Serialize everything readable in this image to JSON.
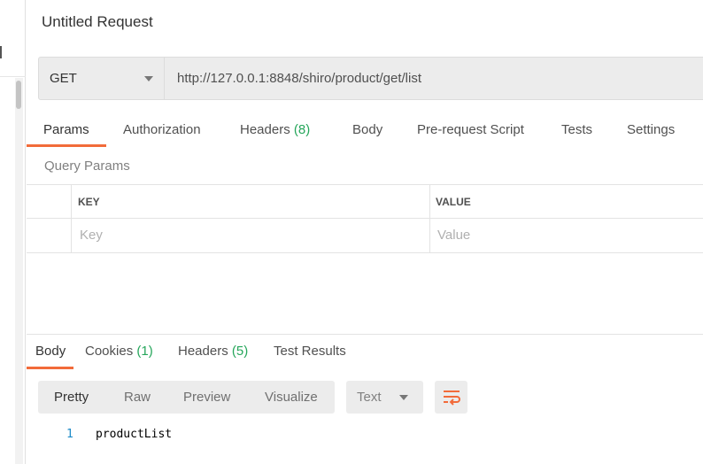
{
  "request": {
    "title": "Untitled Request",
    "method": "GET",
    "url": "http://127.0.0.1:8848/shiro/product/get/list"
  },
  "request_tabs": [
    {
      "label": "Params",
      "count": ""
    },
    {
      "label": "Authorization",
      "count": ""
    },
    {
      "label": "Headers",
      "count": "(8)"
    },
    {
      "label": "Body",
      "count": ""
    },
    {
      "label": "Pre-request Script",
      "count": ""
    },
    {
      "label": "Tests",
      "count": ""
    },
    {
      "label": "Settings",
      "count": ""
    }
  ],
  "query_params": {
    "title": "Query Params",
    "columns": [
      "KEY",
      "VALUE"
    ],
    "placeholders": {
      "key": "Key",
      "value": "Value"
    }
  },
  "response_tabs": [
    {
      "label": "Body",
      "count": ""
    },
    {
      "label": "Cookies",
      "count": "(1)"
    },
    {
      "label": "Headers",
      "count": "(5)"
    },
    {
      "label": "Test Results",
      "count": ""
    }
  ],
  "view_modes": [
    "Pretty",
    "Raw",
    "Preview",
    "Visualize"
  ],
  "format": "Text",
  "body": {
    "line_numbers": [
      "1"
    ],
    "lines": [
      "productList"
    ]
  },
  "colors": {
    "accent": "#f26b3a",
    "count": "#26a65b",
    "line_number": "#1d8bc8"
  },
  "icons": {
    "wrap": "wrap-lines-icon",
    "caret": "caret-down-icon"
  }
}
